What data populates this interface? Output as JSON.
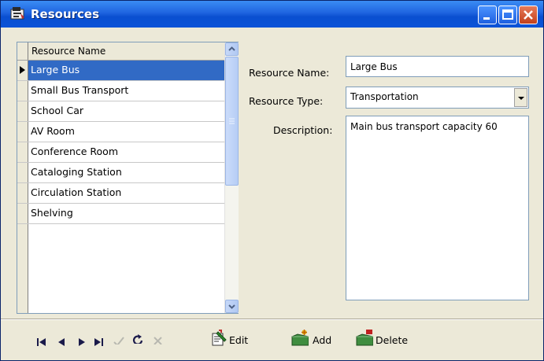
{
  "window": {
    "title": "Resources",
    "icon": "app-window-icon",
    "controls": [
      "minimize-icon",
      "maximize-icon",
      "close-icon"
    ]
  },
  "grid": {
    "column_header": "Resource Name",
    "rows": [
      {
        "name": "Large Bus",
        "selected": true
      },
      {
        "name": "Small Bus Transport",
        "selected": false
      },
      {
        "name": "School Car",
        "selected": false
      },
      {
        "name": "AV Room",
        "selected": false
      },
      {
        "name": "Conference Room",
        "selected": false
      },
      {
        "name": "Cataloging Station",
        "selected": false
      },
      {
        "name": "Circulation Station",
        "selected": false
      },
      {
        "name": "Shelving",
        "selected": false
      }
    ]
  },
  "form": {
    "resource_name_label": "Resource Name:",
    "resource_name_value": "Large Bus",
    "resource_type_label": "Resource Type:",
    "resource_type_value": "Transportation",
    "description_label": "Description:",
    "description_value": "Main bus transport capacity 60"
  },
  "toolbar": {
    "navigator": [
      "first-record-icon",
      "prior-record-icon",
      "next-record-icon",
      "last-record-icon",
      "post-icon",
      "refresh-icon",
      "cancel-icon"
    ],
    "edit_label": "Edit",
    "add_label": "Add",
    "delete_label": "Delete"
  },
  "colors": {
    "selection": "#316ac5",
    "titlebar": "#0b53d8",
    "face": "#ece9d8"
  }
}
